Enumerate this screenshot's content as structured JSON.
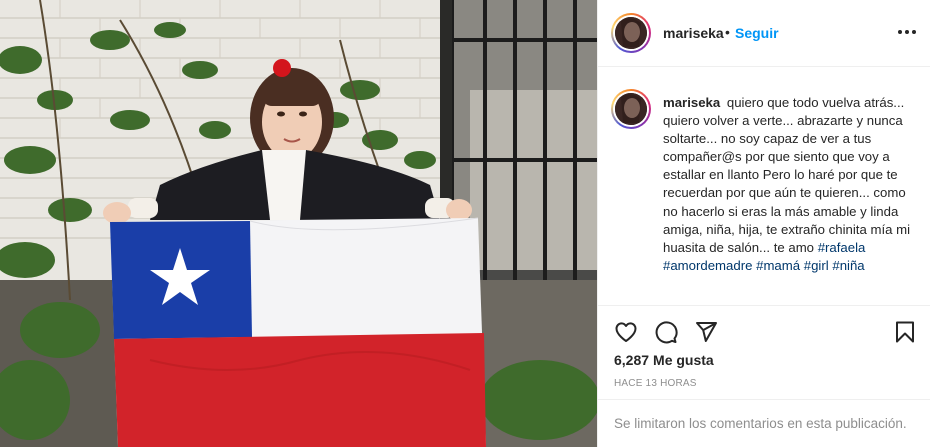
{
  "post": {
    "username": "mariseka",
    "dot": "•",
    "follow_label": "Seguir",
    "more_icon": "more-options-icon"
  },
  "caption": {
    "username": "mariseka",
    "text": "quiero que todo vuelva atrás... quiero volver a verte... abrazarte y nunca soltarte... no soy capaz de ver a tus compañer@s por que siento que voy a estallar en llanto Pero lo haré por que te recuerdan por que aún te quieren... como no hacerlo si eras la más amable y linda amiga, niña, hija, te extraño chinita mía mi huasita de salón... te amo",
    "hashtags": [
      "#rafaela",
      "#amordemadre",
      "#mamá",
      "#girl",
      "#niña"
    ]
  },
  "actions": {
    "like_icon": "heart-icon",
    "comment_icon": "comment-icon",
    "share_icon": "share-icon",
    "save_icon": "bookmark-icon"
  },
  "likes": {
    "count": "6,287",
    "label": "Me gusta"
  },
  "time": "HACE 13 HORAS",
  "comments_disabled": "Se limitaron los comentarios en esta publicación.",
  "colors": {
    "link_blue": "#0095f6",
    "hashtag_blue": "#00376b",
    "flag_blue": "#1a3ea8",
    "flag_red": "#d2232a",
    "flag_white": "#f4f4f6"
  }
}
